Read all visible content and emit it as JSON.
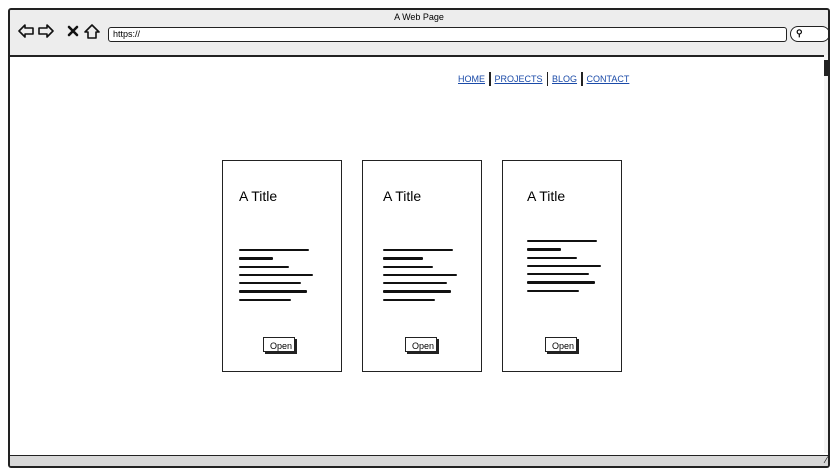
{
  "window": {
    "title": "A Web Page"
  },
  "toolbar": {
    "back_icon": "arrow-left-icon",
    "forward_icon": "arrow-right-icon",
    "close_icon": "x-icon",
    "home_icon": "home-icon",
    "url": "https://",
    "search_icon": "magnifier-icon"
  },
  "nav": {
    "items": [
      {
        "label": "HOME"
      },
      {
        "label": "PROJECTS"
      },
      {
        "label": "BLOG"
      },
      {
        "label": "CONTACT"
      }
    ]
  },
  "cards": [
    {
      "title": "A Title",
      "button_label": "Open"
    },
    {
      "title": "A Title",
      "button_label": "Open"
    },
    {
      "title": "A Title",
      "button_label": "Open"
    }
  ],
  "colors": {
    "link": "#1a4aa8",
    "chrome": "#ededed",
    "border": "#222222"
  }
}
